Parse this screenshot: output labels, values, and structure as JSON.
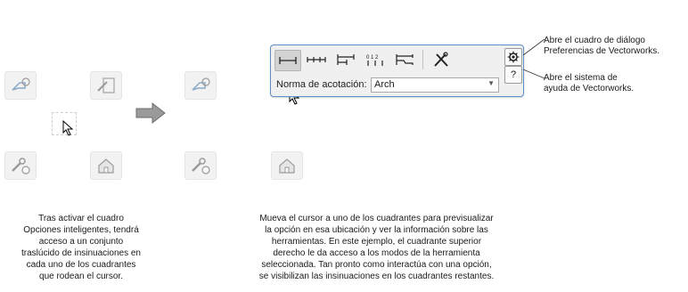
{
  "toolbar_panel": {
    "dimension_standard_label": "Norma de acotación:",
    "dimension_standard_value": "Arch",
    "settings_button_icon": "gear-icon",
    "help_button_label": "?"
  },
  "callouts": {
    "preferences": [
      "Abre el cuadro de diálogo",
      "Preferencias de Vectorworks."
    ],
    "help": [
      "Abre el sistema de",
      "ayuda de Vectorworks."
    ]
  },
  "captions": {
    "left": [
      "Tras activar el cuadro",
      "Opciones inteligentes, tendrá",
      "acceso a un conjunto",
      "traslúcido de insinuaciones en",
      "cada uno de los cuadrantes",
      "que rodean el cursor."
    ],
    "right": [
      "Mueva el cursor a uno de los cuadrantes para previsualizar",
      "la opción en esa ubicación y ver la información sobre las",
      "herramientas. En este ejemplo, el cuadrante superior",
      "derecho le da acceso a los modos de la herramienta",
      "seleccionada. Tan pronto como interactúa con una opción,",
      "se visibilizan las insinuaciones en los cuadrantes restantes."
    ]
  },
  "colors": {
    "panel_border": "#5f8fc4",
    "panel_bg": "#f0f0f0",
    "quadrant_bg": "#f2f2f2",
    "arrow_gray": "#8a8a8a"
  }
}
